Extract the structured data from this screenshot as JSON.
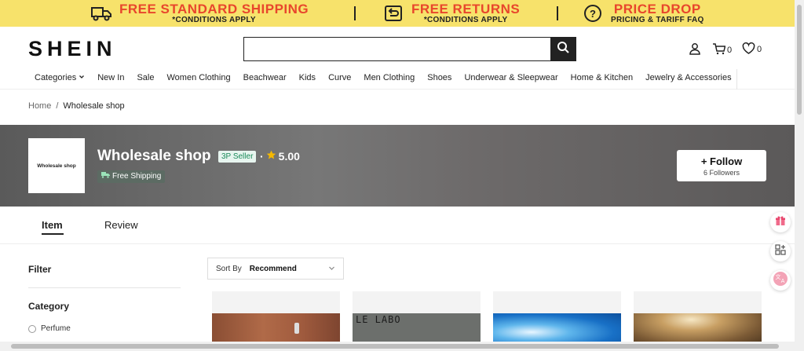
{
  "promo": {
    "items": [
      {
        "title": "FREE STANDARD SHIPPING",
        "sub": "*CONDITIONS APPLY",
        "icon": "truck-icon"
      },
      {
        "title": "FREE RETURNS",
        "sub": "*CONDITIONS APPLY",
        "icon": "return-icon"
      },
      {
        "title": "PRICE DROP",
        "sub": "PRICING & TARIFF FAQ",
        "icon": "price-tag-icon"
      }
    ],
    "bg": "#f7e26b",
    "accent": "#e8462c"
  },
  "header": {
    "logo": "SHEIN",
    "search": {
      "value": "",
      "placeholder": ""
    },
    "cart_count": "0",
    "wishlist_count": "0"
  },
  "nav": {
    "items": [
      "Categories",
      "New In",
      "Sale",
      "Women Clothing",
      "Beachwear",
      "Kids",
      "Curve",
      "Men Clothing",
      "Shoes",
      "Underwear & Sleepwear",
      "Home & Kitchen",
      "Jewelry & Accessories"
    ]
  },
  "breadcrumb": {
    "home": "Home",
    "sep": "/",
    "current": "Wholesale shop"
  },
  "store": {
    "logo_text": "Wholesale shop",
    "name": "Wholesale shop",
    "seller_badge": "3P Seller",
    "rating_sep": "·",
    "rating": "5.00",
    "shipping": "Free Shipping",
    "follow": "+ Follow",
    "followers": "6 Followers"
  },
  "tabs": {
    "item": "Item",
    "review": "Review",
    "active": "Item"
  },
  "filter": {
    "title": "Filter",
    "category_title": "Category",
    "options": [
      "Perfume"
    ]
  },
  "sort": {
    "label": "Sort By",
    "value": "Recommend"
  },
  "products": [
    {
      "brand_text": ""
    },
    {
      "brand_text": "LE LABO"
    },
    {
      "brand_text": ""
    },
    {
      "brand_text": ""
    }
  ]
}
